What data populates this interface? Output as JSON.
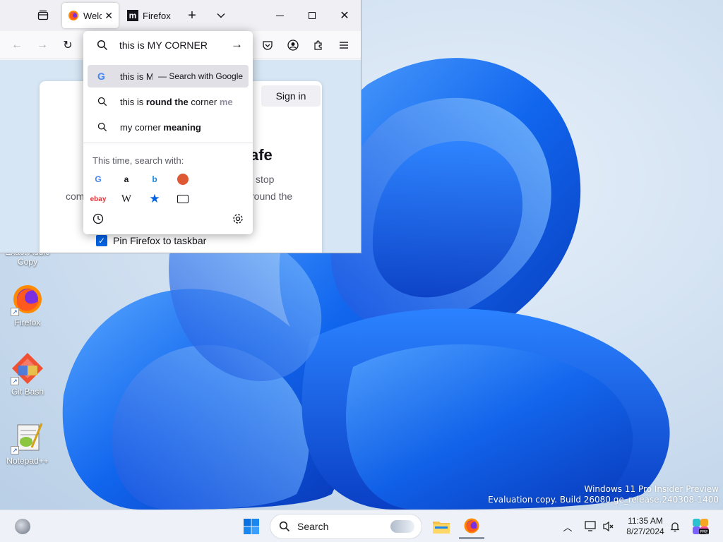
{
  "desktop": {
    "icons": [
      {
        "label": "Exact Audio Copy"
      },
      {
        "label": "Firefox"
      },
      {
        "label": "Git Bash"
      },
      {
        "label": "Notepad++"
      }
    ],
    "watermark": {
      "line1": "Windows 11 Pro Insider Preview",
      "line2": "Evaluation copy. Build 26080.ge_release.240308-1400"
    }
  },
  "browser": {
    "tabs": [
      {
        "label": "Welcome",
        "active": true
      },
      {
        "label": "Firefox",
        "active": false
      }
    ],
    "address_bar": {
      "value": "this is MY CORNER"
    },
    "page": {
      "sign_in": "Sign in",
      "heading_fragment": "afe",
      "body_line1_right": "stop",
      "body_line2_left": "com",
      "body_line2_right": "round the",
      "pin_label": "Pin Firefox to taskbar",
      "pin_checked": true
    },
    "suggestions": [
      {
        "prefix": "this is M",
        "suffix": "— Search with Google",
        "selected": true,
        "icon": "google-icon"
      },
      {
        "prefix": "this is ",
        "bold": "round the",
        "rest": " corner ",
        "bold2": "me",
        "icon": "search-icon"
      },
      {
        "prefix": "my corner ",
        "bold": "meaning",
        "icon": "search-icon"
      }
    ],
    "engines_label": "This time, search with:",
    "engines": [
      "Google",
      "Amazon",
      "Bing",
      "DuckDuckGo",
      "eBay",
      "Wikipedia",
      "Bookmarks",
      "Tabs"
    ]
  },
  "taskbar": {
    "search_placeholder": "Search",
    "time": "11:35 AM",
    "date": "8/27/2024"
  },
  "colors": {
    "accent": "#0061e0",
    "wallpaper_blue": "#1a5fe0"
  }
}
